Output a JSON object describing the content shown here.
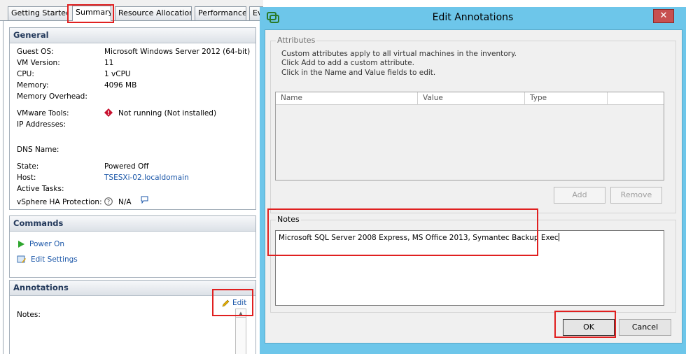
{
  "tabs": [
    "Getting Started",
    "Summary",
    "Resource Allocation",
    "Performance",
    "Ev"
  ],
  "general": {
    "title": "General",
    "rows": [
      {
        "label": "Guest OS:",
        "value": "Microsoft Windows Server 2012 (64-bit)"
      },
      {
        "label": "VM Version:",
        "value": "11"
      },
      {
        "label": "CPU:",
        "value": "1 vCPU"
      },
      {
        "label": "Memory:",
        "value": "4096 MB"
      },
      {
        "label": "Memory Overhead:",
        "value": ""
      },
      {
        "label": "VMware Tools:",
        "value": "Not running (Not installed)"
      },
      {
        "label": "IP Addresses:",
        "value": ""
      },
      {
        "label": "DNS Name:",
        "value": ""
      },
      {
        "label": "State:",
        "value": "Powered Off"
      },
      {
        "label": "Host:",
        "value": "TSESXi-02.localdomain"
      },
      {
        "label": "Active Tasks:",
        "value": ""
      },
      {
        "label": "vSphere HA Protection:",
        "value": "N/A"
      }
    ]
  },
  "commands": {
    "title": "Commands",
    "power_on": "Power On",
    "edit_settings": "Edit Settings"
  },
  "annotations": {
    "title": "Annotations",
    "edit": "Edit",
    "notes_label": "Notes:"
  },
  "dialog": {
    "title": "Edit Annotations",
    "close": "✕",
    "attributes": {
      "label": "Attributes",
      "desc": [
        "Custom attributes apply to all virtual machines in the inventory.",
        "Click Add to add a custom attribute.",
        "Click in the Name and Value fields to edit."
      ],
      "columns": [
        "Name",
        "Value",
        "Type"
      ],
      "add": "Add",
      "remove": "Remove"
    },
    "notes": {
      "label": "Notes",
      "value": "Microsoft SQL Server 2008 Express, MS Office 2013, Symantec Backup Exec"
    },
    "ok": "OK",
    "cancel": "Cancel"
  },
  "colors": {
    "title_bar": "#6dc6ea",
    "link": "#1a56a8",
    "highlight": "#e02020",
    "header_text": "#23395b"
  }
}
